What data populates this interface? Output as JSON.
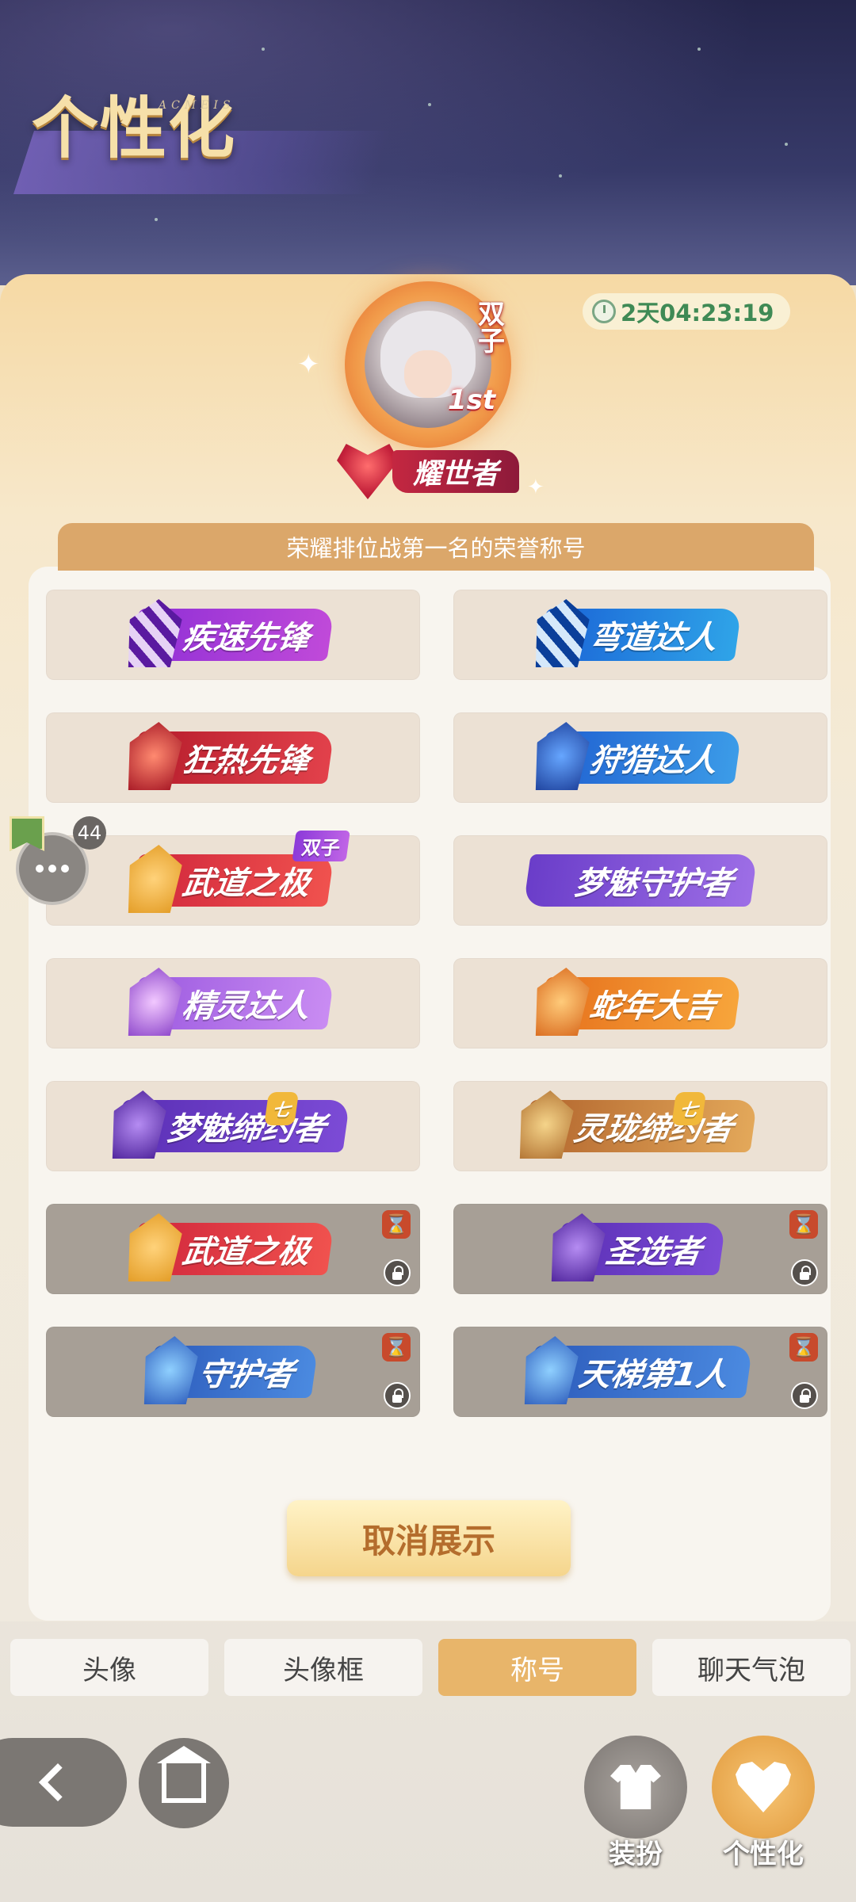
{
  "page": {
    "title": "个性化",
    "title_sub": "ACMEIS"
  },
  "timer": {
    "text": "2天04:23:19"
  },
  "avatar": {
    "tag": "双子",
    "rank": "1st"
  },
  "current_title": {
    "label": "耀世者"
  },
  "description": "荣耀排位战第一名的荣誉称号",
  "titles": [
    {
      "label": "疾速先锋",
      "style": "purple",
      "locked": false
    },
    {
      "label": "弯道达人",
      "style": "blue",
      "locked": false
    },
    {
      "label": "狂热先锋",
      "style": "red",
      "locked": false
    },
    {
      "label": "狩猎达人",
      "style": "navy",
      "locked": false
    },
    {
      "label": "武道之极",
      "sub": "双子",
      "style": "crimson",
      "locked": false
    },
    {
      "label": "梦魅守护者",
      "style": "violet",
      "locked": false
    },
    {
      "label": "精灵达人",
      "style": "lavender",
      "locked": false
    },
    {
      "label": "蛇年大吉",
      "style": "orange",
      "locked": false
    },
    {
      "label": "梦魅缔约者",
      "style": "deep",
      "locked": false,
      "corner": "七"
    },
    {
      "label": "灵珑缔约者",
      "style": "gold",
      "locked": false,
      "corner": "七"
    },
    {
      "label": "武道之极",
      "style": "crimson",
      "locked": true
    },
    {
      "label": "圣选者",
      "style": "deep",
      "locked": true
    },
    {
      "label": "守护者",
      "style": "steel",
      "locked": true
    },
    {
      "label": "天梯第1人",
      "style": "steel",
      "locked": true
    }
  ],
  "cancel_button": "取消展示",
  "chat": {
    "count": "44"
  },
  "tabs": [
    {
      "label": "头像",
      "active": false
    },
    {
      "label": "头像框",
      "active": false
    },
    {
      "label": "称号",
      "active": true
    },
    {
      "label": "聊天气泡",
      "active": false
    }
  ],
  "bottom_actions": {
    "dress_label": "装扮",
    "personal_label": "个性化"
  }
}
